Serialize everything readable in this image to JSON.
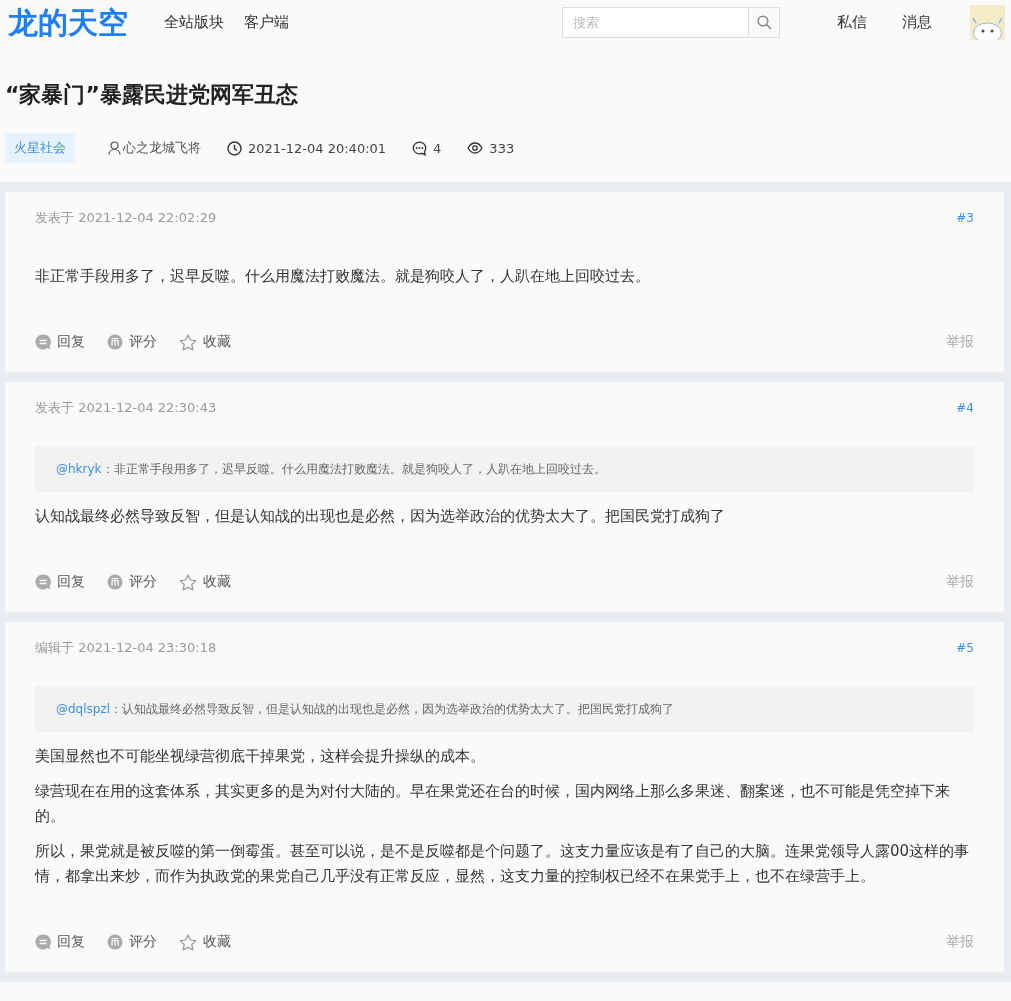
{
  "header": {
    "logo": "龙的天空",
    "nav": [
      {
        "label": "全站版块"
      },
      {
        "label": "客户端"
      }
    ],
    "search": {
      "placeholder": "搜索"
    },
    "links": [
      {
        "label": "私信"
      },
      {
        "label": "消息"
      }
    ]
  },
  "topic": {
    "title": "“家暴门”暴露民进党网军丑态",
    "tag": "火星社会",
    "author": "心之龙城飞将",
    "time": "2021-12-04 20:40:01",
    "replies": "4",
    "views": "333"
  },
  "posts": [
    {
      "meta": "发表于 2021-12-04 22:02:29",
      "floor": "#3",
      "paragraphs": [
        "非正常手段用多了，迟早反噬。什么用魔法打败魔法。就是狗咬人了，人趴在地上回咬过去。"
      ],
      "actions": [
        {
          "kind": "reply",
          "label": "回复"
        },
        {
          "kind": "rate",
          "label": "评分"
        },
        {
          "kind": "favorite",
          "label": "收藏"
        }
      ],
      "report": "举报"
    },
    {
      "meta": "发表于 2021-12-04 22:30:43",
      "floor": "#4",
      "quote": {
        "user": "@hkryk",
        "text": "：非正常手段用多了，迟早反噬。什么用魔法打败魔法。就是狗咬人了，人趴在地上回咬过去。"
      },
      "paragraphs": [
        "认知战最终必然导致反智，但是认知战的出现也是必然，因为选举政治的优势太大了。把国民党打成狗了"
      ],
      "actions": [
        {
          "kind": "reply",
          "label": "回复"
        },
        {
          "kind": "rate",
          "label": "评分"
        },
        {
          "kind": "favorite",
          "label": "收藏"
        }
      ],
      "report": "举报"
    },
    {
      "meta": "编辑于 2021-12-04 23:30:18",
      "floor": "#5",
      "quote": {
        "user": "@dqlspzl",
        "text": "：认知战最终必然导致反智，但是认知战的出现也是必然，因为选举政治的优势太大了。把国民党打成狗了"
      },
      "paragraphs": [
        "美国显然也不可能坐视绿营彻底干掉果党，这样会提升操纵的成本。",
        "绿营现在在用的这套体系，其实更多的是为对付大陆的。早在果党还在台的时候，国内网络上那么多果迷、翻案迷，也不可能是凭空掉下来的。",
        "所以，果党就是被反噬的第一倒霉蛋。甚至可以说，是不是反噬都是个问题了。这支力量应该是有了自己的大脑。连果党领导人露00这样的事情，都拿出来炒，而作为执政党的果党自己几乎没有正常反应，显然，这支力量的控制权已经不在果党手上，也不在绿营手上。"
      ],
      "actions": [
        {
          "kind": "reply",
          "label": "回复"
        },
        {
          "kind": "rate",
          "label": "评分"
        },
        {
          "kind": "favorite",
          "label": "收藏"
        }
      ],
      "report": "举报"
    }
  ]
}
